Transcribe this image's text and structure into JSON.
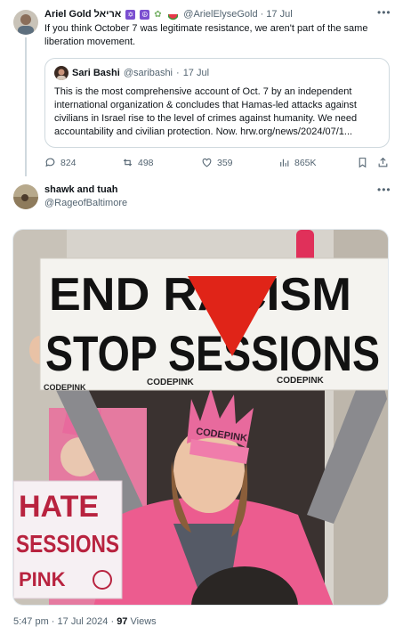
{
  "tweet1": {
    "name": "Ariel Gold",
    "name_hebrew": "אריאל",
    "handle": "@ArielElyseGold",
    "date": "17 Jul",
    "text": "If you think October 7 was legitimate resistance, we aren't part of the same liberation movement.",
    "quote": {
      "name": "Sari Bashi",
      "handle": "@saribashi",
      "date": "17 Jul",
      "text": "This is the most comprehensive account of Oct. 7 by an independent international organization & concludes that Hamas-led attacks against civilians in Israel rise to the level of crimes against humanity. We need accountability and civilian protection. Now. hrw.org/news/2024/07/1..."
    },
    "replies": "824",
    "reposts": "498",
    "likes": "359",
    "views": "865K"
  },
  "tweet2": {
    "name": "shawk and tuah",
    "handle": "@RageofBaltimore",
    "photo": {
      "sign_line1": "END RACISM",
      "sign_line2": "STOP SESSIONS",
      "sign_brand": "CODEPINK",
      "sign2_line1": "HATE",
      "sign2_line2": "SESSIONS",
      "sign2_line3": "PINK",
      "crown_text": "CODEPINK"
    }
  },
  "footer": {
    "time": "5:47 pm · 17 Jul 2024 · ",
    "views_count": "97",
    "views_label": " Views"
  },
  "colors": {
    "accent_pink": "#e63f8a",
    "triangle_red": "#e02418",
    "muted": "#536471"
  }
}
